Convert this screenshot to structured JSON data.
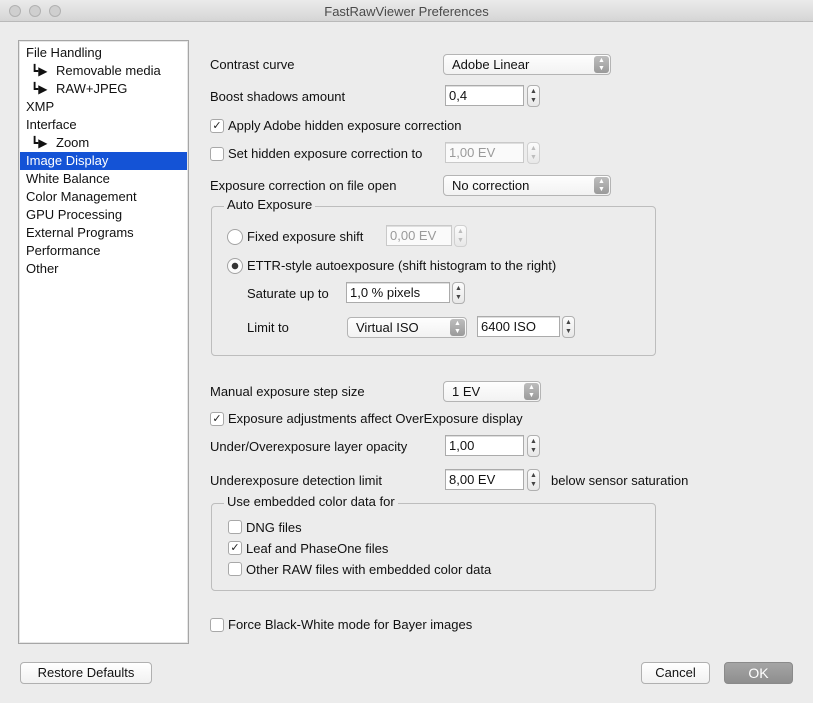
{
  "window": {
    "title": "FastRawViewer Preferences"
  },
  "sidebar": {
    "items": [
      {
        "label": "File Handling"
      },
      {
        "label": "Removable media",
        "arrow": "┗▶"
      },
      {
        "label": "RAW+JPEG",
        "arrow": "┗▶"
      },
      {
        "label": "XMP"
      },
      {
        "label": "Interface"
      },
      {
        "label": "Zoom",
        "arrow": "┗▶"
      },
      {
        "label": "Image Display",
        "selected": true
      },
      {
        "label": "White Balance"
      },
      {
        "label": "Color Management"
      },
      {
        "label": "GPU Processing"
      },
      {
        "label": "External Programs"
      },
      {
        "label": "Performance"
      },
      {
        "label": "Other"
      }
    ]
  },
  "settings": {
    "contrast_curve": {
      "label": "Contrast curve",
      "value": "Adobe Linear"
    },
    "boost_shadows": {
      "label": "Boost shadows amount",
      "value": "0,4"
    },
    "apply_adobe_hidden": {
      "label": "Apply Adobe hidden exposure correction",
      "checked": true
    },
    "set_hidden": {
      "label": "Set hidden exposure correction to",
      "checked": false,
      "value": "1,00 EV"
    },
    "exposure_on_open": {
      "label": "Exposure correction on file open",
      "value": "No correction"
    },
    "auto_exposure": {
      "title": "Auto Exposure",
      "fixed_shift": {
        "label": "Fixed exposure shift",
        "value": "0,00 EV",
        "selected": false
      },
      "ettr": {
        "label": "ETTR-style autoexposure (shift histogram to the right)",
        "selected": true
      },
      "saturate": {
        "label": "Saturate up to",
        "value": "1,0 % pixels"
      },
      "limit": {
        "label": "Limit to",
        "mode": "Virtual ISO",
        "value": "6400 ISO"
      }
    },
    "manual_step": {
      "label": "Manual exposure step size",
      "value": "1 EV"
    },
    "affect_overexposure": {
      "label": "Exposure adjustments affect OverExposure display",
      "checked": true
    },
    "layer_opacity": {
      "label": "Under/Overexposure layer opacity",
      "value": "1,00"
    },
    "underexposure_limit": {
      "label": "Underexposure detection limit",
      "value": "8,00 EV",
      "suffix": "below sensor saturation"
    },
    "embedded_color": {
      "title": "Use embedded color data for",
      "dng": {
        "label": "DNG files",
        "checked": false
      },
      "leaf": {
        "label": "Leaf and PhaseOne files",
        "checked": true
      },
      "other": {
        "label": "Other RAW files with embedded color data",
        "checked": false
      }
    },
    "force_bw": {
      "label": "Force Black-White mode for Bayer images",
      "checked": false
    }
  },
  "buttons": {
    "restore": "Restore Defaults",
    "cancel": "Cancel",
    "ok": "OK"
  },
  "glyphs": {
    "check": "✓",
    "up": "▲",
    "down": "▼"
  },
  "colors": {
    "selection": "#1453d6",
    "window_bg": "#ececec"
  }
}
